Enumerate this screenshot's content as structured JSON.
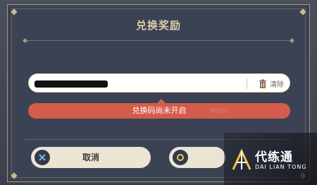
{
  "dialog": {
    "title": "兑换奖励",
    "input": {
      "value": "",
      "clear_label": "清除"
    },
    "error_message": "兑换码尚未开启",
    "buttons": {
      "cancel_label": "取消"
    }
  },
  "watermark": {
    "title": "代练通",
    "subtitle": "DAI LIAN TONG",
    "faint_brand": "Mhih"
  },
  "colors": {
    "error": "#d45c4c",
    "accent_gold": "#a8977a",
    "dialog_bg": "#3b4254"
  }
}
